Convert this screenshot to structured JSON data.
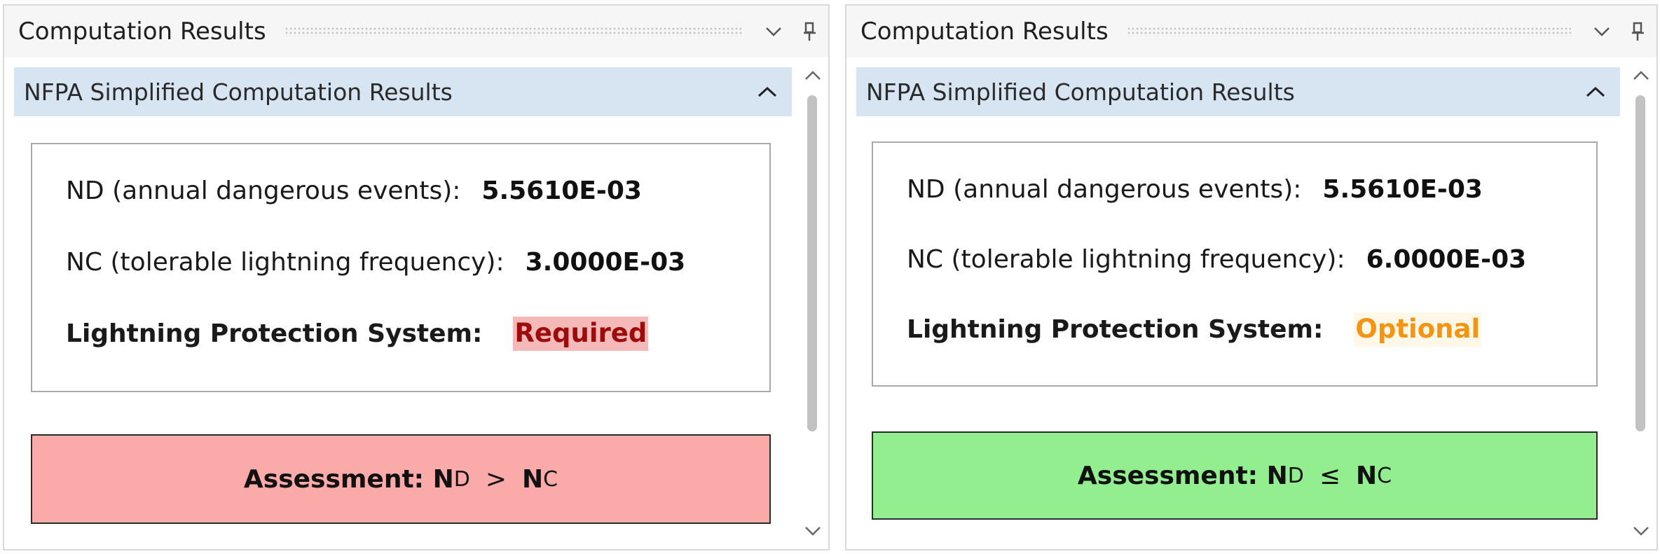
{
  "panels": [
    {
      "title": "Computation Results",
      "section": "NFPA Simplified Computation Results",
      "nd_label": "ND (annual dangerous events):",
      "nd_value": "5.5610E-03",
      "nc_label": "NC (tolerable lightning frequency):",
      "nc_value": "3.0000E-03",
      "lps_label": "Lightning Protection System:",
      "lps_status": "Required",
      "assessment": {
        "prefix": "Assessment: N",
        "sub1": "D",
        "operator": ">",
        "mid": "N",
        "sub2": "C",
        "background": "#fbaaaa"
      }
    },
    {
      "title": "Computation Results",
      "section": "NFPA Simplified Computation Results",
      "nd_label": "ND (annual dangerous events):",
      "nd_value": "5.5610E-03",
      "nc_label": "NC (tolerable lightning frequency):",
      "nc_value": "6.0000E-03",
      "lps_label": "Lightning Protection System:",
      "lps_status": "Optional",
      "assessment": {
        "prefix": "Assessment: N",
        "sub1": "D",
        "operator": "≤",
        "mid": "N",
        "sub2": "C",
        "background": "#93ee8f"
      }
    }
  ],
  "colors": {
    "required_text": "#9e0b0b",
    "required_bg": "#f6b9b9",
    "optional_text": "#f39412",
    "section_header_bg": "#d7e4f1"
  },
  "icons": [
    "chevron-down-icon",
    "pin-icon",
    "chevron-up-icon",
    "scroll-up-icon",
    "scroll-down-icon"
  ]
}
